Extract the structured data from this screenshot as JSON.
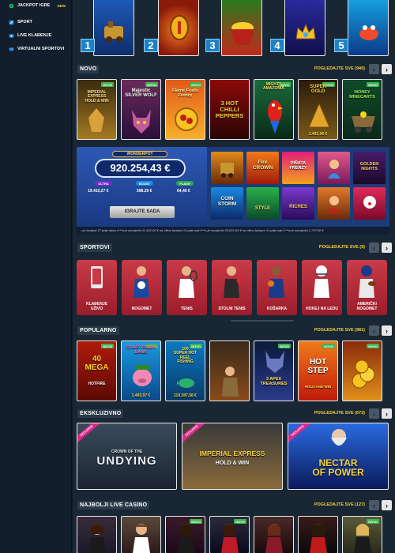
{
  "sidebar": {
    "items": [
      {
        "label": "JACKPOT IGRE",
        "tag": "NEW"
      },
      {
        "label": "SPORT"
      },
      {
        "label": "LIVE KLAĐENJE"
      },
      {
        "label": "VIRTUALNI SPORTOVI"
      }
    ]
  },
  "top": {
    "numbers": [
      "1",
      "2",
      "3",
      "4",
      "5"
    ]
  },
  "novo": {
    "title": "NOVO",
    "link": "POGLEDAJTE SVE (940)",
    "tiles": [
      {
        "lines": [
          "IMPERIAL EXPRESS",
          "HOLD & WIN"
        ],
        "badge": "NOVO"
      },
      {
        "lines": [
          "Majestic",
          "SILVER WOLF"
        ],
        "badge": "NOVO"
      },
      {
        "lines": [
          "Flame Fruits",
          "Frenzy"
        ],
        "badge": "NOVO"
      },
      {
        "lines": [
          "3 HOT",
          "CHILLI",
          "PEPPERS"
        ],
        "badge": ""
      },
      {
        "lines": [
          "MIGHTY",
          "AMAZONIA"
        ],
        "badge": "NOVO"
      },
      {
        "lines": [
          "SUPER",
          "GOLD"
        ],
        "badge": "NOVO",
        "jackpot": "1.493,96 €"
      },
      {
        "lines": [
          "MONEY",
          "MINECARTS"
        ],
        "badge": "NOVO"
      }
    ]
  },
  "wonderpot": {
    "title": "WONDERPOT",
    "amount": "920.254,43 €",
    "tiers": [
      {
        "name": "ULTRA",
        "value": "19.410,27 €"
      },
      {
        "name": "BOOST",
        "value": "598,29 €"
      },
      {
        "name": "FLASH",
        "value": "64,46 €"
      }
    ],
    "cta": "IGRAJTE SADA",
    "ticker": "ral Jackpot 27 prije dana     o***a je osvojio/la 11.401,00 € na Ultra Jackpot 13 prije sati     f***n je osvojio/la 29.821,00 € na Ultra Jackpot 14 prije sati     1***a je osvojio/la 1.747,00 €",
    "games": [
      {
        "lines": [
          ""
        ]
      },
      {
        "lines": [
          "Fire",
          "CROWN"
        ]
      },
      {
        "lines": [
          "PIÑATA",
          "FRENZY"
        ]
      },
      {
        "lines": [
          ""
        ]
      },
      {
        "lines": [
          "GOLDEN",
          "NIGHTS"
        ]
      },
      {
        "lines": [
          "COIN",
          "STORM"
        ]
      },
      {
        "lines": [
          "STYLE"
        ]
      },
      {
        "lines": [
          "RICHES"
        ]
      },
      {
        "lines": [
          ""
        ]
      },
      {
        "lines": [
          ""
        ]
      }
    ]
  },
  "sportovi": {
    "title": "SPORTOVI",
    "link": "POGLEDAJTE SVE (9)",
    "items": [
      {
        "lines": [
          "KLAĐENJE",
          "UŽIVO"
        ]
      },
      {
        "lines": [
          "NOGOMET"
        ]
      },
      {
        "lines": [
          "TENIS"
        ]
      },
      {
        "lines": [
          "STOLNI TENIS"
        ]
      },
      {
        "lines": [
          "KOŠARKA"
        ]
      },
      {
        "lines": [
          "HOKEJ NA LEDU"
        ]
      },
      {
        "lines": [
          "AMERIČKI",
          "NOGOMET"
        ]
      }
    ]
  },
  "popularno": {
    "title": "POPULARNO",
    "link": "POGLEDAJTE SVE (981)",
    "tiles": [
      {
        "lines": [
          "40",
          "MEGA",
          "HOTFIRE"
        ],
        "badge": "NOVO"
      },
      {
        "lines": [
          "CRAZY",
          "PIGGY",
          "BANK"
        ],
        "badge": "NOVO",
        "jackpot": "1.493,97 €"
      },
      {
        "lines": [
          "100",
          "SUPER HOT",
          "REEL",
          "FISHING"
        ],
        "badge": "NOVO",
        "jackpot": "119.287,58 €"
      },
      {
        "lines": [
          ""
        ],
        "badge": ""
      },
      {
        "lines": [
          "3",
          "APEX",
          "TREASURES"
        ],
        "badge": "NOVO"
      },
      {
        "lines": [
          "HOT",
          "STEP",
          "HOLD AND WIN"
        ],
        "badge": "NOVO"
      },
      {
        "lines": [
          ""
        ],
        "badge": "NOVO"
      }
    ]
  },
  "ekskluzivno": {
    "title": "EKSKLUZIVNO",
    "link": "POGLEDAJTE SVE (672)",
    "tiles": [
      {
        "lines": [
          "CROWN OF THE",
          "UNDYING"
        ],
        "ribbon": "EXCLUSIVE"
      },
      {
        "lines": [
          "IMPERIAL EXPRESS",
          "HOLD & WIN"
        ],
        "ribbon": "EXCLUSIVE"
      },
      {
        "lines": [
          "NECTAR",
          "OF POWER"
        ],
        "ribbon": "EXCLUSIVE"
      }
    ]
  },
  "live": {
    "title": "NAJBOLJI LIVE CASINO",
    "link": "POGLEDAJTE SVE (127)",
    "badges": [
      "",
      "",
      "NOVO",
      "NOVO",
      "",
      "",
      "NOVO"
    ]
  }
}
